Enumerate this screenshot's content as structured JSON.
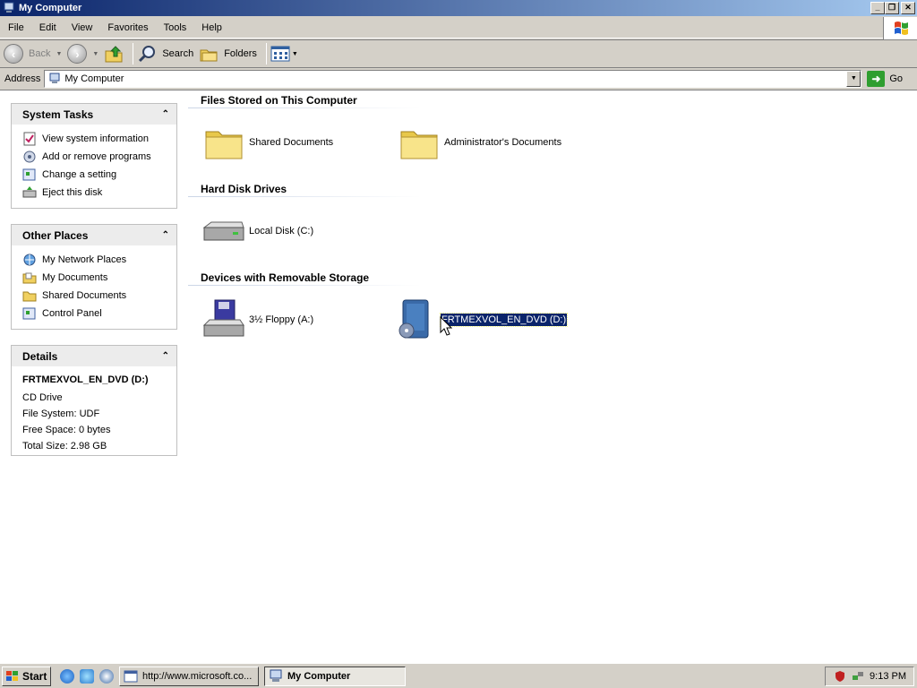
{
  "window": {
    "title": "My Computer"
  },
  "menu": [
    "File",
    "Edit",
    "View",
    "Favorites",
    "Tools",
    "Help"
  ],
  "toolbar": {
    "back": "Back",
    "search": "Search",
    "folders": "Folders"
  },
  "address": {
    "label": "Address",
    "value": "My Computer",
    "go": "Go"
  },
  "panels": {
    "system_tasks": {
      "title": "System Tasks",
      "items": [
        "View system information",
        "Add or remove programs",
        "Change a setting",
        "Eject this disk"
      ]
    },
    "other_places": {
      "title": "Other Places",
      "items": [
        "My Network Places",
        "My Documents",
        "Shared Documents",
        "Control Panel"
      ]
    },
    "details": {
      "title": "Details",
      "name": "FRTMEXVOL_EN_DVD (D:)",
      "type": "CD Drive",
      "file_system": "File System: UDF",
      "free_space": "Free Space: 0 bytes",
      "total_size": "Total Size: 2.98 GB"
    }
  },
  "sections": {
    "files": {
      "title": "Files Stored on This Computer",
      "items": [
        "Shared Documents",
        "Administrator's Documents"
      ]
    },
    "hard_disks": {
      "title": "Hard Disk Drives",
      "items": [
        "Local Disk (C:)"
      ]
    },
    "removable": {
      "title": "Devices with Removable Storage",
      "items": [
        "3½ Floppy (A:)",
        "FRTMEXVOL_EN_DVD (D:)"
      ]
    }
  },
  "taskbar": {
    "start": "Start",
    "tasks": [
      "http://www.microsoft.co...",
      "My Computer"
    ],
    "clock": "9:13 PM"
  }
}
